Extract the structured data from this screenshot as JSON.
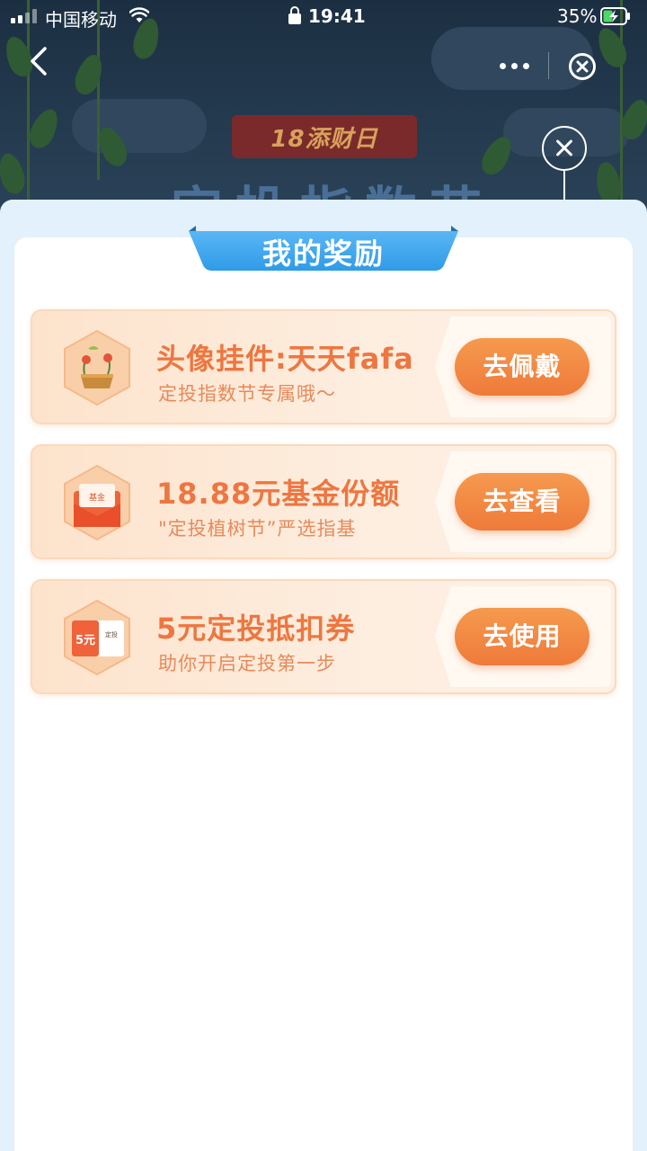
{
  "status_bar": {
    "carrier": "中国移动",
    "time": "19:41",
    "battery_percent": "35%"
  },
  "nav": {
    "back_icon": "chevron-left-icon",
    "more_icon": "more-dots-icon",
    "close_icon": "close-circle-icon"
  },
  "banner": {
    "badge_text": "18添财日",
    "heading_text": "定投指数节"
  },
  "modal": {
    "title": "我的奖励",
    "close_icon": "close-icon"
  },
  "rewards": [
    {
      "title": "头像挂件:天天fafa",
      "subtitle": "定投指数节专属哦～",
      "action": "去佩戴",
      "icon": "avatar-pendant-icon"
    },
    {
      "title": "18.88元基金份额",
      "subtitle": "\"定投植树节”严选指基",
      "action": "去查看",
      "icon": "fund-red-envelope-icon",
      "icon_label": "基金"
    },
    {
      "title": "5元定投抵扣券",
      "subtitle": "助你开启定投第一步",
      "action": "去使用",
      "icon": "coupon-icon",
      "icon_label": "5元",
      "icon_side_label": "定投"
    }
  ],
  "colors": {
    "accent_orange": "#ef7a3a",
    "title_blue": "#2f9be8",
    "modal_bg": "#e2f1fb"
  }
}
